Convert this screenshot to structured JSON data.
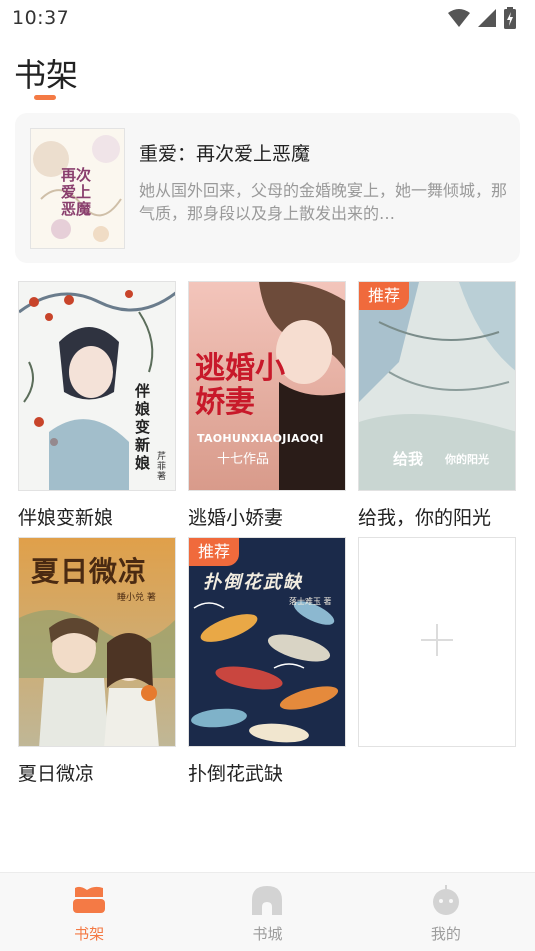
{
  "status_bar": {
    "time": "10:37"
  },
  "page": {
    "title": "书架"
  },
  "recent": {
    "title": "重爱：再次爱上恶魔",
    "description": "她从国外回来，父母的金婚晚宴上，她一舞倾城，那气质，那身段以及身上散发出来的…",
    "cover_text": "再次爱上恶魔"
  },
  "books": [
    {
      "title": "伴娘变新娘",
      "cover_text": "伴娘变新娘",
      "cover_author": "芹菲著",
      "badge": ""
    },
    {
      "title": "逃婚小娇妻",
      "cover_text": "逃婚小娇妻",
      "cover_pinyin": "TAOHUNXIAOJIAOQI",
      "cover_author": "十七作品",
      "badge": ""
    },
    {
      "title": "给我，你的阳光",
      "cover_text": "给我",
      "cover_text2": "你的阳光",
      "badge": "推荐"
    },
    {
      "title": "夏日微凉",
      "cover_text": "夏日微凉",
      "cover_author": "睡小兑 著",
      "badge": ""
    },
    {
      "title": "扑倒花武缺",
      "cover_text": "扑倒花武缺",
      "cover_author": "落士难玉 著",
      "badge": "推荐"
    }
  ],
  "nav": {
    "items": [
      {
        "label": "书架",
        "icon": "bookshelf-icon",
        "active": true
      },
      {
        "label": "书城",
        "icon": "store-icon",
        "active": false
      },
      {
        "label": "我的",
        "icon": "profile-icon",
        "active": false
      }
    ]
  },
  "colors": {
    "accent": "#f47a45",
    "badge": "#f06a3c",
    "inactive": "#d3d3d3"
  }
}
